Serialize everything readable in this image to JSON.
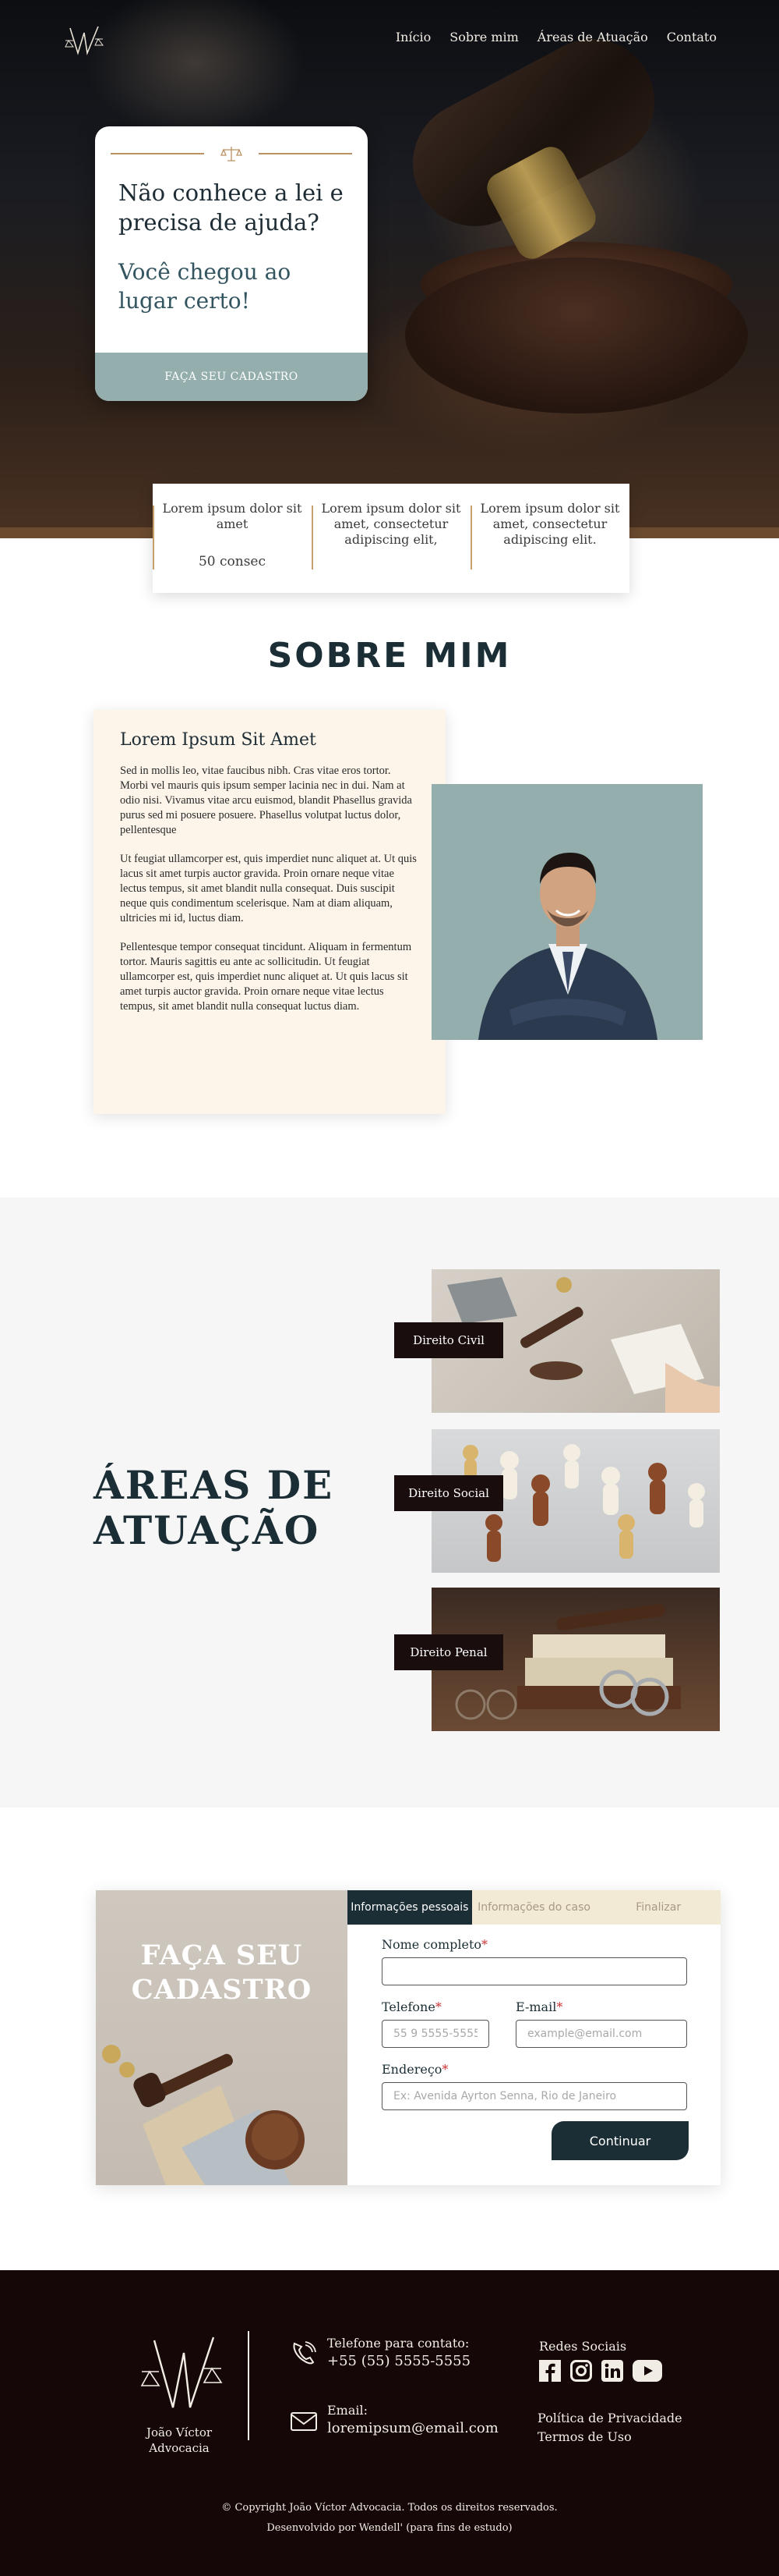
{
  "nav": {
    "items": [
      {
        "label": "Início"
      },
      {
        "label": "Sobre mim"
      },
      {
        "label": "Áreas de Atuação"
      },
      {
        "label": "Contato"
      }
    ]
  },
  "hero": {
    "title": "Não conhece a lei e precisa de ajuda?",
    "subtitle": "Você chegou ao lugar certo!",
    "cta_label": "FAÇA SEU CADASTRO"
  },
  "stats": [
    {
      "text": "Lorem ipsum dolor sit amet",
      "sub": "50 consec"
    },
    {
      "text": "Lorem ipsum dolor sit amet, consectetur adipiscing elit,",
      "sub": ""
    },
    {
      "text": "Lorem ipsum dolor sit amet, consectetur adipiscing elit.",
      "sub": ""
    }
  ],
  "about": {
    "section_title": "SOBRE MIM",
    "card_title": "Lorem Ipsum Sit Amet",
    "paragraphs": [
      "Sed in mollis leo, vitae faucibus nibh. Cras vitae eros tortor. Morbi vel mauris quis ipsum semper lacinia nec in dui. Nam at odio nisi. Vivamus vitae arcu euismod, blandit  Phasellus gravida purus sed mi posuere posuere. Phasellus volutpat luctus dolor, pellentesque",
      "Ut feugiat ullamcorper est, quis imperdiet nunc aliquet at. Ut quis lacus sit amet turpis auctor gravida. Proin ornare neque vitae lectus tempus, sit amet blandit nulla consequat. Duis suscipit neque quis condimentum scelerisque. Nam at diam aliquam, ultricies mi id, luctus diam.",
      "Pellentesque tempor consequat tincidunt. Aliquam in fermentum tortor. Mauris sagittis eu ante ac sollicitudin. Ut feugiat ullamcorper est, quis imperdiet nunc aliquet at. Ut quis lacus sit amet turpis auctor gravida. Proin ornare neque vitae lectus tempus, sit amet blandit nulla consequat luctus diam."
    ]
  },
  "areas": {
    "title_line1": "ÁREAS DE",
    "title_line2": "ATUAÇÃO",
    "items": [
      {
        "label": "Direito Civil"
      },
      {
        "label": "Direito Social"
      },
      {
        "label": "Direito Penal"
      }
    ]
  },
  "cadastro": {
    "title_line1": "FAÇA SEU",
    "title_line2": "CADASTRO",
    "tabs": [
      {
        "label": "Informações pessoais"
      },
      {
        "label": "Informações do caso"
      },
      {
        "label": "Finalizar"
      }
    ],
    "fields": {
      "name_label": "Nome completo",
      "name_value": "",
      "phone_label": "Telefone",
      "phone_placeholder": "55 9 5555-5555",
      "email_label": "E-mail",
      "email_placeholder": "example@email.com",
      "address_label": "Endereço",
      "address_placeholder": "Ex: Avenida Ayrton Senna, Rio de Janeiro",
      "required_mark": "*"
    },
    "continue_label": "Continuar"
  },
  "footer": {
    "brand_line1": "João Víctor",
    "brand_line2": "Advocacia",
    "phone_title": "Telefone para contato:",
    "phone_value": "+55 (55) 5555-5555",
    "email_title": "Email:",
    "email_value": "loremipsum@email.com",
    "social_title": "Redes Sociais",
    "social_icons": [
      "facebook-icon",
      "instagram-icon",
      "linkedin-icon",
      "youtube-icon"
    ],
    "privacy_label": "Política de Privacidade",
    "terms_label": "Termos de Uso",
    "copyright": "© Copyright João Víctor Advocacia. Todos os direitos reservados.",
    "credit": "Desenvolvido por Wendell' (para fins de estudo)"
  },
  "colors": {
    "primary": "#1b2e35",
    "sage": "#93aeac",
    "gold": "#c7a06b",
    "cream": "#fdf5ea",
    "footer_bg": "#150707"
  }
}
